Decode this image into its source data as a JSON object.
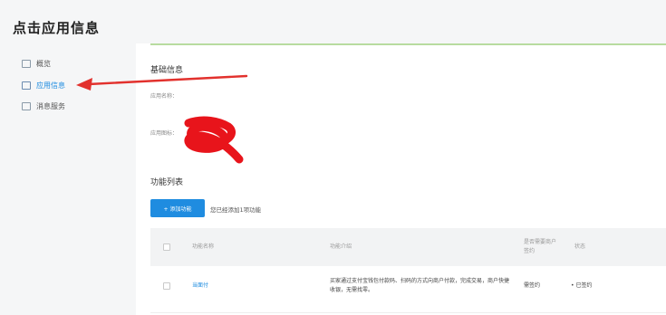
{
  "page_title": "点击应用信息",
  "sidebar": {
    "items": [
      {
        "label": "概览",
        "icon": "monitor-icon",
        "active": false
      },
      {
        "label": "应用信息",
        "icon": "grid-icon",
        "active": true
      },
      {
        "label": "消息服务",
        "icon": "screen-icon",
        "active": false
      }
    ]
  },
  "basic_info": {
    "title": "基础信息",
    "app_name_label": "应用名称：",
    "app_name_value": "",
    "app_icon_label": "应用图标："
  },
  "feature_list": {
    "title": "功能列表",
    "add_button_label": "+ 添加功能",
    "added_count_text": "您已经添加1项功能"
  },
  "table": {
    "columns": [
      "功能名称",
      "功能介绍",
      "是否需要商户签约",
      "状态"
    ],
    "rows": [
      {
        "name": "当面付",
        "description": "买家通过支付宝钱包付款码、扫码的方式向商户付款，完成交易，商户快捷收银，无需找零。",
        "sign_required": "需签约",
        "status": "• 已签约"
      }
    ]
  },
  "colors": {
    "accent": "#1f8ce0",
    "annotation_arrow": "#e2312d",
    "redaction": "#e8141b"
  }
}
